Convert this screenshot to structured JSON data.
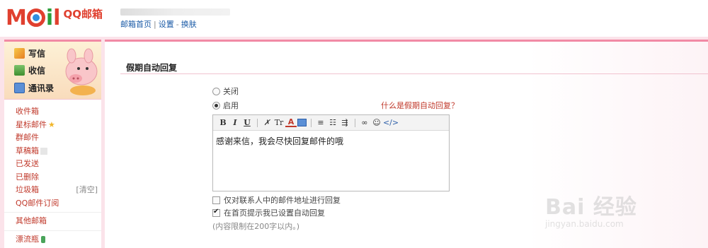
{
  "header": {
    "logo": {
      "mail": "Mail",
      "brand": "QQ邮箱"
    },
    "links": [
      "邮箱首页",
      "设置",
      "换肤"
    ],
    "link_separators": [
      "|",
      "-"
    ]
  },
  "sidebar": {
    "quick_actions": [
      {
        "label": "写信",
        "icon": "pencil-icon"
      },
      {
        "label": "收信",
        "icon": "inbox-download-icon"
      },
      {
        "label": "通讯录",
        "icon": "address-book-icon"
      }
    ],
    "folders": [
      {
        "label": "收件箱"
      },
      {
        "label": "星标邮件",
        "icon": "star-icon"
      },
      {
        "label": "群邮件"
      },
      {
        "label": "草稿箱"
      },
      {
        "label": "已发送"
      },
      {
        "label": "已删除"
      },
      {
        "label": "垃圾箱",
        "action": "[清空]"
      },
      {
        "label": "QQ邮件订阅"
      }
    ],
    "other_folders": [
      {
        "label": "其他邮箱"
      },
      {
        "label": "漂流瓶",
        "icon": "bottle-icon"
      }
    ]
  },
  "main": {
    "title": "假期自动回复",
    "options": {
      "off_label": "关闭",
      "on_label": "启用",
      "selected": "启用"
    },
    "help_link": "什么是假期自动回复？",
    "toolbar": {
      "bold": "B",
      "italic": "I",
      "underline": "U",
      "font": "Tr",
      "color": "A",
      "code": "</>"
    },
    "editor_text": "感谢来信，我会尽快回复邮件的哦",
    "checkboxes": [
      {
        "label": "仅对联系人中的邮件地址进行回复",
        "checked": false
      },
      {
        "label": "在首页提示我已设置自动回复",
        "checked": true
      }
    ],
    "limit_note": "(内容限制在200字以内。)"
  },
  "watermark": {
    "main": "Bai 经验",
    "sub": "jingyan.baidu.com"
  },
  "colors": {
    "accent": "#f18aa5",
    "brand_red": "#e0402f",
    "link_blue": "#1a5aa6",
    "folder_red": "#c0392b"
  }
}
